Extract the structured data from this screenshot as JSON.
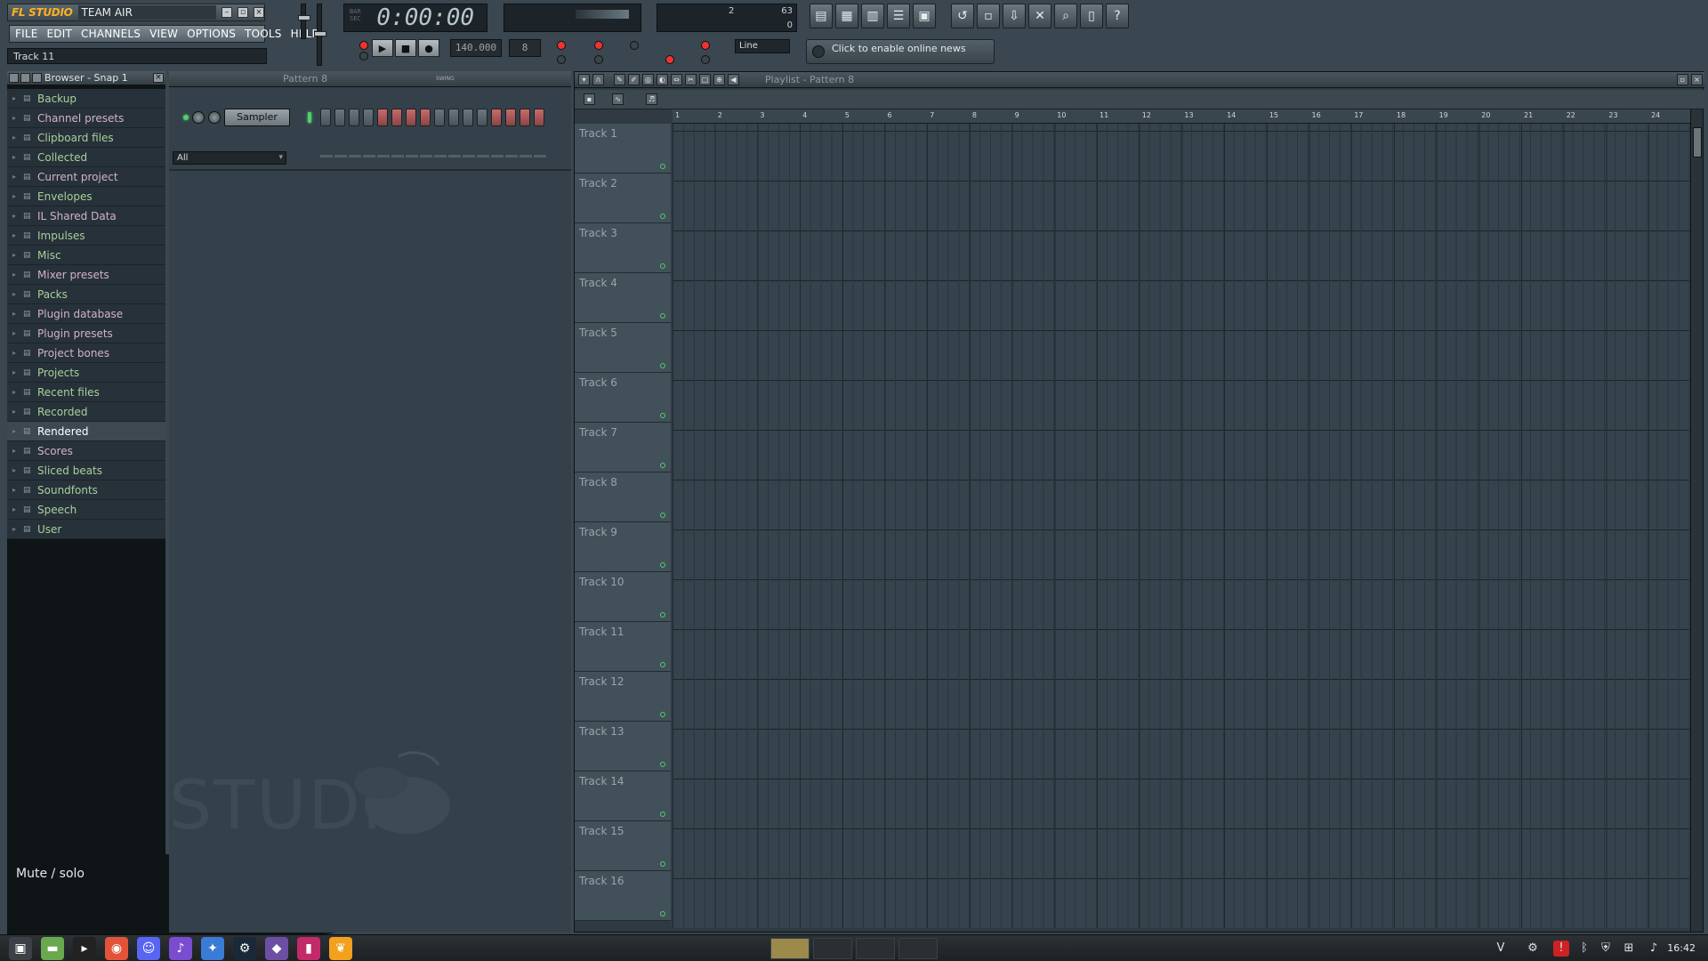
{
  "app": {
    "logo": "FL STUDIO",
    "title": "TEAM AIR"
  },
  "menu": [
    "FILE",
    "EDIT",
    "CHANNELS",
    "VIEW",
    "OPTIONS",
    "TOOLS",
    "HELP"
  ],
  "hint_bar": "Track 11",
  "transport": {
    "time": "0:00:00",
    "tempo": "140.000",
    "pattern_num": "8",
    "snap": "Line",
    "cpu_value": "63",
    "poly_value": "0",
    "mem_value": "2"
  },
  "news": "Click to enable online news",
  "browser": {
    "title": "Browser - Snap 1",
    "items": [
      {
        "label": "Backup",
        "color": "green"
      },
      {
        "label": "Channel presets",
        "color": "pink"
      },
      {
        "label": "Clipboard files",
        "color": "green"
      },
      {
        "label": "Collected",
        "color": "green"
      },
      {
        "label": "Current project",
        "color": "pink"
      },
      {
        "label": "Envelopes",
        "color": "green"
      },
      {
        "label": "IL Shared Data",
        "color": "pink"
      },
      {
        "label": "Impulses",
        "color": "green"
      },
      {
        "label": "Misc",
        "color": "green"
      },
      {
        "label": "Mixer presets",
        "color": "pink"
      },
      {
        "label": "Packs",
        "color": "green"
      },
      {
        "label": "Plugin database",
        "color": "pink"
      },
      {
        "label": "Plugin presets",
        "color": "pink"
      },
      {
        "label": "Project bones",
        "color": "pink"
      },
      {
        "label": "Projects",
        "color": "green"
      },
      {
        "label": "Recent files",
        "color": "green"
      },
      {
        "label": "Recorded",
        "color": "green"
      },
      {
        "label": "Rendered",
        "color": "green",
        "selected": true
      },
      {
        "label": "Scores",
        "color": "pink"
      },
      {
        "label": "Sliced beats",
        "color": "green"
      },
      {
        "label": "Soundfonts",
        "color": "green"
      },
      {
        "label": "Speech",
        "color": "green"
      },
      {
        "label": "User",
        "color": "green"
      }
    ]
  },
  "hint_popup": "Mute / solo",
  "step_sequencer": {
    "pattern": "Pattern 8",
    "swing_label": "SWING",
    "channel": "Sampler",
    "filter": "All",
    "steps": 16,
    "watermark": "STUDIO"
  },
  "playlist": {
    "title": "Playlist - Pattern 8",
    "bars": [
      "1",
      "2",
      "3",
      "4",
      "5",
      "6",
      "7",
      "8",
      "9",
      "10",
      "11",
      "12",
      "13",
      "14",
      "15",
      "16",
      "17",
      "18",
      "19",
      "20",
      "21",
      "22",
      "23",
      "24"
    ],
    "tracks": [
      "Track 1",
      "Track 2",
      "Track 3",
      "Track 4",
      "Track 5",
      "Track 6",
      "Track 7",
      "Track 8",
      "Track 9",
      "Track 10",
      "Track 11",
      "Track 12",
      "Track 13",
      "Track 14",
      "Track 15",
      "Track 16"
    ]
  },
  "taskbar": {
    "clock": "16:42"
  },
  "colors": {
    "accent": "#ffb020",
    "led_green": "#4fd06a",
    "step_red": "#c96a6a"
  }
}
